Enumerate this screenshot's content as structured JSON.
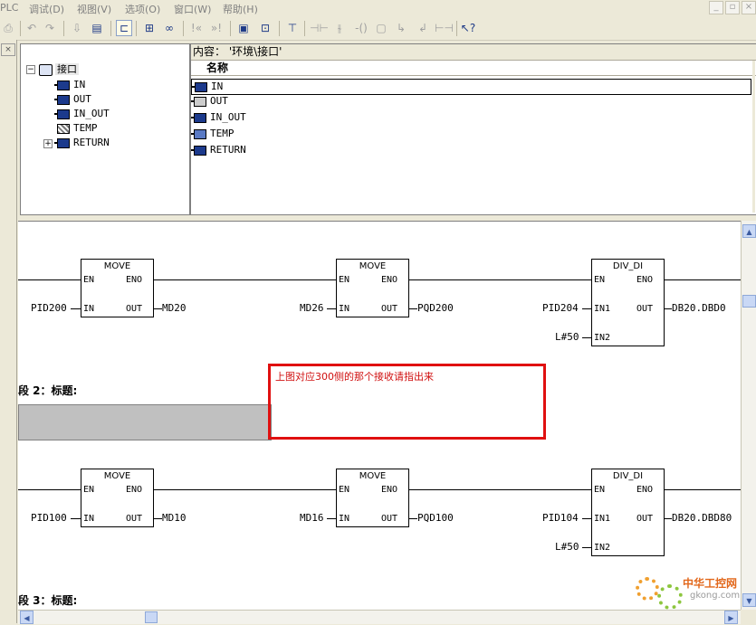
{
  "menubar": {
    "items": [
      "PLC",
      "调试(D)",
      "视图(V)",
      "选项(O)",
      "窗口(W)",
      "帮助(H)"
    ]
  },
  "interface_panel": {
    "tree_root": "接口",
    "tree_items": [
      "IN",
      "OUT",
      "IN_OUT",
      "TEMP",
      "RETURN"
    ]
  },
  "content_panel": {
    "title": "内容：  '环境\\接口'",
    "column_header": "名称",
    "rows": [
      "IN",
      "OUT",
      "IN_OUT",
      "TEMP",
      "RETURN"
    ]
  },
  "ladder": {
    "network1": {
      "blocks": [
        {
          "name": "MOVE",
          "pins": [
            "EN",
            "ENO",
            "IN",
            "OUT"
          ],
          "input": "PID200",
          "output": "MD20"
        },
        {
          "name": "MOVE",
          "pins": [
            "EN",
            "ENO",
            "IN",
            "OUT"
          ],
          "input": "MD26",
          "output": "PQD200"
        },
        {
          "name": "DIV_DI",
          "pins": [
            "EN",
            "ENO",
            "IN1",
            "OUT",
            "IN2"
          ],
          "input1": "PID204",
          "input2": "L#50",
          "output": "DB20.DBD0"
        }
      ]
    },
    "segment2_title": "段 2：标题:",
    "network2": {
      "blocks": [
        {
          "name": "MOVE",
          "pins": [
            "EN",
            "ENO",
            "IN",
            "OUT"
          ],
          "input": "PID100",
          "output": "MD10"
        },
        {
          "name": "MOVE",
          "pins": [
            "EN",
            "ENO",
            "IN",
            "OUT"
          ],
          "input": "MD16",
          "output": "PQD100"
        },
        {
          "name": "DIV_DI",
          "pins": [
            "EN",
            "ENO",
            "IN1",
            "OUT",
            "IN2"
          ],
          "input1": "PID104",
          "input2": "L#50",
          "output": "DB20.DBD80"
        }
      ]
    },
    "segment3_title": "段 3：标题:"
  },
  "annotation": {
    "text": "上图对应300侧的那个接收请指出来",
    "color": "#e01010"
  },
  "watermark": {
    "name": "中华工控网",
    "url": "gkong.com"
  },
  "colors": {
    "window_bg": "#ece9d8",
    "annotation": "#e01010",
    "segment_bar": "#c0c0c0",
    "interface_icon": "#1c3a8c"
  }
}
